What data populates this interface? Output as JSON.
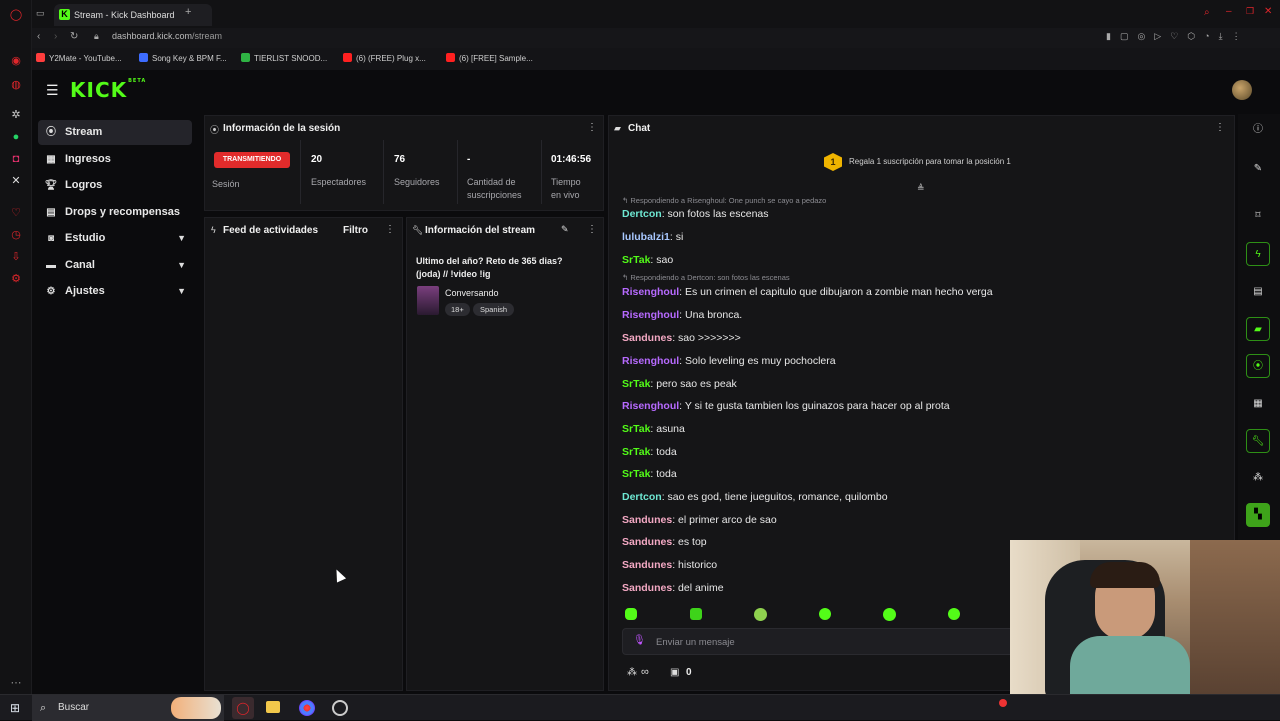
{
  "browser": {
    "tab_title": "Stream - Kick Dashboard",
    "url_host": "dashboard.kick.com",
    "url_path": "/stream",
    "bookmarks": [
      {
        "label": "Y2Mate - YouTube...",
        "color": "#ff3d3d"
      },
      {
        "label": "Song Key & BPM F...",
        "color": "#3d6cff"
      },
      {
        "label": "TIERLIST SNOOD...",
        "color": "#2fb344"
      },
      {
        "label": "(6) (FREE) Plug x...",
        "color": "#ff2020"
      },
      {
        "label": "(6) [FREE] Sample...",
        "color": "#ff2020"
      }
    ]
  },
  "brand": {
    "logo": "KICK",
    "beta": "BETA",
    "accent": "#53fc18"
  },
  "sidebar": {
    "items": [
      {
        "label": "Stream",
        "icon": "broadcast-icon"
      },
      {
        "label": "Ingresos",
        "icon": "chart-icon"
      },
      {
        "label": "Logros",
        "icon": "trophy-icon"
      },
      {
        "label": "Drops y recompensas",
        "icon": "gift-icon"
      },
      {
        "label": "Estudio",
        "icon": "studio-icon"
      },
      {
        "label": "Canal",
        "icon": "channel-icon"
      },
      {
        "label": "Ajustes",
        "icon": "gear-icon"
      }
    ]
  },
  "session": {
    "title": "Información de la sesión",
    "badge": "TRANSMITIENDO",
    "session_label": "Sesión",
    "stats": [
      {
        "value": "20",
        "label": "Espectadores"
      },
      {
        "value": "76",
        "label": "Seguidores"
      },
      {
        "value": "-",
        "label": "Cantidad de suscripciones"
      },
      {
        "value": "01:46:56",
        "label": "Tiempo en vivo"
      }
    ]
  },
  "feed": {
    "title": "Feed de actividades",
    "filter": "Filtro"
  },
  "streaminfo": {
    "title": "Información del stream",
    "stream_title": "Ultimo del año? Reto de 365 dias? (joda) // !video !ig",
    "category": "Conversando",
    "tags": [
      "18+",
      "Spanish"
    ]
  },
  "chat": {
    "title": "Chat",
    "sub_goal_rank": "1",
    "sub_goal_text": "Regala 1 suscripción para tomar la posición 1",
    "input_placeholder": "Enviar un mensaje",
    "infinite": "∞",
    "gift_count": "0",
    "colors": {
      "teal": "#6ee7d2",
      "lightblue": "#a8c8ff",
      "green": "#53fc18",
      "purple": "#b76aff",
      "pink": "#f4a9c4"
    },
    "lines": [
      {
        "kind": "reply",
        "text": "Respondiendo a Risenghoul: One punch se cayo a pedazo"
      },
      {
        "kind": "msg",
        "user": "Dertcon",
        "text": "son fotos las escenas",
        "color": "teal"
      },
      {
        "kind": "msg",
        "user": "lulubalzi1",
        "text": "si",
        "color": "lightblue"
      },
      {
        "kind": "msg",
        "user": "SrTak",
        "text": "sao",
        "color": "green"
      },
      {
        "kind": "reply",
        "text": "Respondiendo a Dertcon: son fotos las escenas"
      },
      {
        "kind": "msg",
        "user": "Risenghoul",
        "text": "Es un crimen el capitulo que dibujaron a zombie man hecho verga",
        "color": "purple"
      },
      {
        "kind": "msg",
        "user": "Risenghoul",
        "text": "Una bronca.",
        "color": "purple"
      },
      {
        "kind": "msg",
        "user": "Sandunes",
        "text": "sao >>>>>>>",
        "color": "pink"
      },
      {
        "kind": "msg",
        "user": "Risenghoul",
        "text": "Solo leveling es muy pochoclera",
        "color": "purple"
      },
      {
        "kind": "msg",
        "user": "SrTak",
        "text": "pero sao es peak",
        "color": "green"
      },
      {
        "kind": "msg",
        "user": "Risenghoul",
        "text": "Y si te gusta tambien los guinazos para hacer op al prota",
        "color": "purple"
      },
      {
        "kind": "msg",
        "user": "SrTak",
        "text": "asuna",
        "color": "green"
      },
      {
        "kind": "msg",
        "user": "SrTak",
        "text": "toda",
        "color": "green"
      },
      {
        "kind": "msg",
        "user": "SrTak",
        "text": "toda",
        "color": "green"
      },
      {
        "kind": "msg",
        "user": "Dertcon",
        "text": "sao es god, tiene jueguitos, romance, quilombo",
        "color": "teal"
      },
      {
        "kind": "msg",
        "user": "Sandunes",
        "text": "el primer arco de sao",
        "color": "pink"
      },
      {
        "kind": "msg",
        "user": "Sandunes",
        "text": "es top",
        "color": "pink"
      },
      {
        "kind": "msg",
        "user": "Sandunes",
        "text": "historico",
        "color": "pink"
      },
      {
        "kind": "msg",
        "user": "Sandunes",
        "text": "del anime",
        "color": "pink"
      }
    ]
  },
  "taskbar": {
    "search": "Buscar"
  }
}
